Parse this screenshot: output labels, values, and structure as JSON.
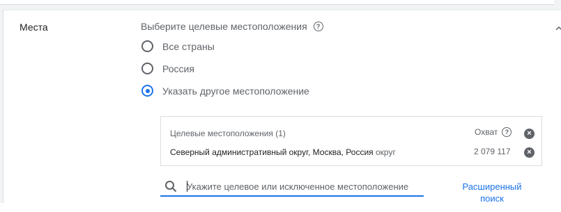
{
  "section": {
    "label": "Места",
    "question": "Выберите целевые местоположения"
  },
  "radios": [
    {
      "label": "Все страны",
      "checked": false
    },
    {
      "label": "Россия",
      "checked": false
    },
    {
      "label": "Указать другое местоположение",
      "checked": true
    }
  ],
  "targets": {
    "header": "Целевые местоположения (1)",
    "reach_header": "Охват",
    "items": [
      {
        "name": "Северный административный округ, Москва, Россия",
        "type": "округ",
        "reach": "2 079 117"
      }
    ]
  },
  "search": {
    "placeholder": "Укажите целевое или исключенное местоположение",
    "value": ""
  },
  "advanced_search": {
    "label": "Расширенный поиск"
  },
  "icons": {
    "help": "help-icon",
    "remove": "remove-icon",
    "search": "search-icon",
    "collapse": "chevron-up-icon"
  },
  "colors": {
    "accent": "#1a73e8",
    "text_primary": "#202124",
    "text_secondary": "#5f6368",
    "border": "#dadce0"
  }
}
